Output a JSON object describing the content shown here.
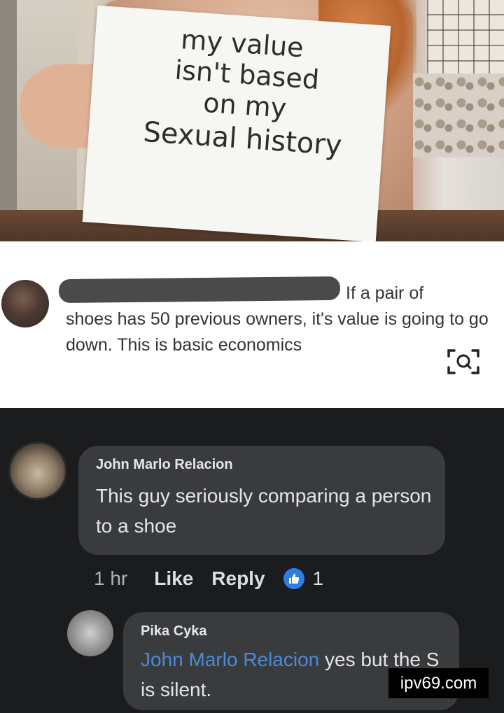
{
  "sign": {
    "lines": [
      "my value",
      "isn't based",
      "on my",
      "Sexual history"
    ]
  },
  "post": {
    "comment_text_first": "If a pair of",
    "comment_text_rest": "shoes has 50 previous owners, it's value is going to go down. This is basic economics",
    "lens_icon": "visual-search-icon"
  },
  "comments": [
    {
      "author": "John Marlo Relacion",
      "text": "This guy seriously comparing a person to a shoe",
      "time": "1 hr",
      "like_label": "Like",
      "reply_label": "Reply",
      "reaction_icon": "thumbs-up-icon",
      "reaction_count": "1"
    },
    {
      "author": "Pika Cyka",
      "mention": "John Marlo Relacion",
      "text": " yes but the S is silent."
    }
  ],
  "watermark": "ipv69.com",
  "colors": {
    "comment_bg": "#1b1c1e",
    "bubble_bg": "#3a3b3c",
    "mention": "#4b8bd9",
    "reaction_blue": "#2d7ee3"
  }
}
